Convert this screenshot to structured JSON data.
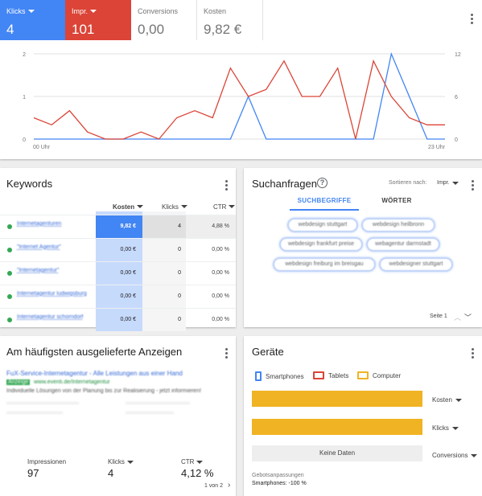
{
  "metrics": [
    {
      "label": "Klicks",
      "value": "4"
    },
    {
      "label": "Impr.",
      "value": "101"
    },
    {
      "label": "Conversions",
      "value": "0,00"
    },
    {
      "label": "Kosten",
      "value": "9,82 €"
    }
  ],
  "colors": {
    "blue": "#4285f4",
    "red": "#db4437",
    "green": "#34a853",
    "yellow": "#f0b323"
  },
  "chart_data": {
    "type": "line",
    "x_start_label": "00 Uhr",
    "x_end_label": "23 Uhr",
    "left_axis_ticks": [
      "0",
      "1",
      "2"
    ],
    "right_axis_ticks": [
      "0",
      "6",
      "12"
    ],
    "ylim_left": [
      0,
      2
    ],
    "ylim_right": [
      0,
      12
    ],
    "series": [
      {
        "axis": "left",
        "color": "#4285f4",
        "values": [
          0,
          0,
          0,
          0,
          0,
          0,
          0,
          0,
          0,
          0,
          0,
          0,
          1,
          0,
          0,
          0,
          0,
          0,
          0,
          0,
          2,
          1,
          0,
          0
        ]
      },
      {
        "axis": "right",
        "color": "#db4437",
        "values": [
          3,
          2,
          4,
          1,
          0,
          0,
          1,
          0,
          3,
          4,
          3,
          10,
          6,
          7,
          11,
          6,
          6,
          10,
          0,
          11,
          6,
          3,
          2,
          2
        ]
      }
    ]
  },
  "keywords": {
    "title": "Keywords",
    "col_kosten": "Kosten",
    "col_klicks": "Klicks",
    "col_ctr": "CTR",
    "rows": [
      {
        "name": "Internetagenturen",
        "kosten": "9,82 €",
        "klicks": "4",
        "ctr": "4,88 %"
      },
      {
        "name": "\"Internet Agentur\"",
        "kosten": "0,00 €",
        "klicks": "0",
        "ctr": "0,00 %"
      },
      {
        "name": "\"Internetagentur\"",
        "kosten": "0,00 €",
        "klicks": "0",
        "ctr": "0,00 %"
      },
      {
        "name": "Internetagentur ludwigsburg",
        "kosten": "0,00 €",
        "klicks": "0",
        "ctr": "0,00 %"
      },
      {
        "name": "Internetagentur schorndorf",
        "kosten": "0,00 €",
        "klicks": "0",
        "ctr": "0,00 %"
      }
    ]
  },
  "search": {
    "title": "Suchanfragen",
    "sort_label": "Sortieren nach:",
    "sort_value": "Impr.",
    "tab_terms": "SUCHBEGRIFFE",
    "tab_words": "WÖRTER",
    "chips": [
      "webdesign stuttgart",
      "webdesign heilbronn",
      "webdesign frankfurt preise",
      "webagentur darmstadt",
      "webdesign freiburg im breisgau",
      "webdesigner stuttgart"
    ],
    "page": "Seite 1"
  },
  "ads": {
    "title": "Am häufigsten ausgelieferte Anzeigen",
    "ad_headline": "FuX-Service-Internetagentur - Alle Leistungen aus einer Hand",
    "ad_badge": "Anzeige",
    "ad_url": "www.eventi.de/Internetagentur",
    "ad_desc": "Individuelle Lösungen von der Planung bis zur Realisierung - jetzt informieren!",
    "impressions_label": "Impressionen",
    "impressions_value": "97",
    "klicks_label": "Klicks",
    "klicks_value": "4",
    "ctr_label": "CTR",
    "ctr_value": "4,12 %",
    "pager": "1 von 2"
  },
  "devices": {
    "title": "Geräte",
    "legend": [
      "Smartphones",
      "Tablets",
      "Computer"
    ],
    "bar_labels": [
      "Kosten",
      "Klicks",
      "Conversions"
    ],
    "no_data": "Keine Daten",
    "adjust_label": "Gebotsanpassungen",
    "adjust_value": "Smartphones: -100 %"
  }
}
